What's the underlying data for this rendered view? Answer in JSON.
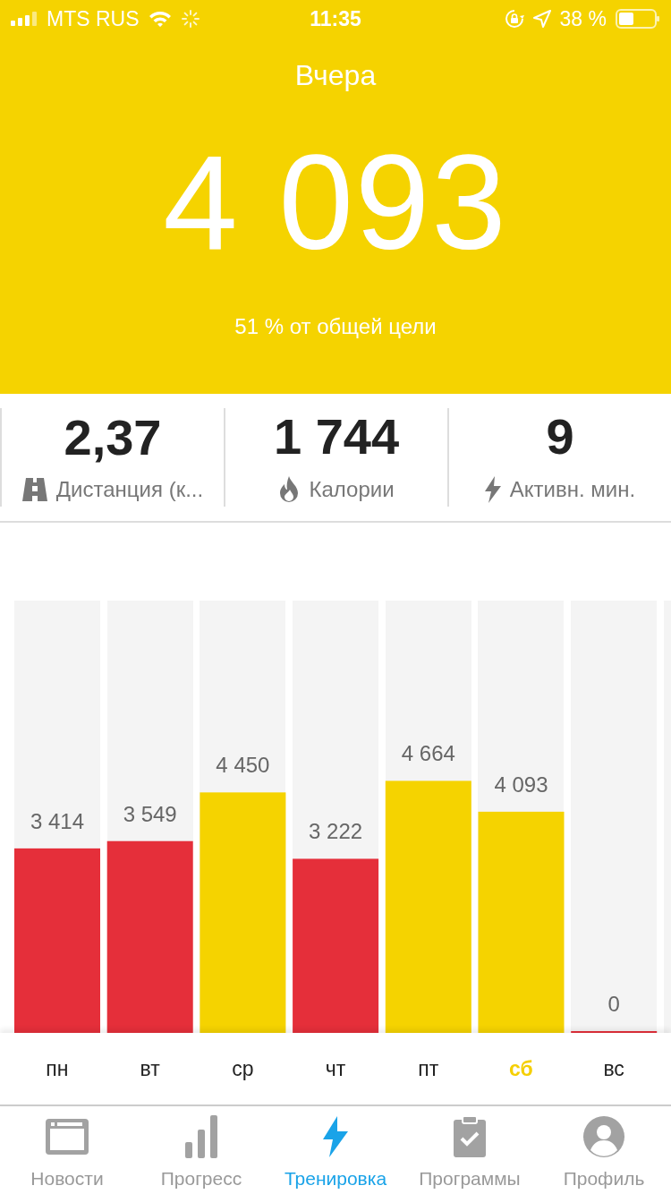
{
  "status_bar": {
    "carrier": "MTS RUS",
    "time": "11:35",
    "battery": "38 %"
  },
  "header": {
    "title": "Вчера",
    "steps": "4 093",
    "goal_text": "51 % от общей цели"
  },
  "stats": [
    {
      "kind": "distance",
      "value": "2,37",
      "label": "Дистанция (к..."
    },
    {
      "kind": "calories",
      "value": "1 744",
      "label": "Калории"
    },
    {
      "kind": "active",
      "value": "9",
      "label": "Активн. мин."
    }
  ],
  "chart_data": {
    "type": "bar",
    "categories": [
      "пн",
      "вт",
      "ср",
      "чт",
      "пт",
      "сб",
      "вс"
    ],
    "ylim": [
      0,
      8000
    ],
    "data_labels": true,
    "series": [
      {
        "color": "#e52f3a",
        "values": [
          3414,
          3549,
          null,
          3222,
          null,
          null,
          0
        ]
      },
      {
        "color": "#f5d300",
        "values": [
          null,
          null,
          4450,
          null,
          4664,
          4093,
          null
        ]
      }
    ]
  },
  "value_labels": [
    "3 414",
    "3 549",
    "4 450",
    "3 222",
    "4 664",
    "4 093",
    "0"
  ],
  "day_tabs": [
    {
      "selected": false
    },
    {
      "selected": false
    },
    {
      "selected": false
    },
    {
      "selected": false
    },
    {
      "selected": false
    },
    {
      "selected": true
    },
    {
      "selected": false
    }
  ],
  "tab_bar": [
    {
      "kind": "news",
      "label": "Новости",
      "selected": false
    },
    {
      "kind": "progress",
      "label": "Прогресс",
      "selected": false
    },
    {
      "kind": "workout",
      "label": "Тренировка",
      "selected": true
    },
    {
      "kind": "programs",
      "label": "Программы",
      "selected": false
    },
    {
      "kind": "profile",
      "label": "Профиль",
      "selected": false
    }
  ]
}
